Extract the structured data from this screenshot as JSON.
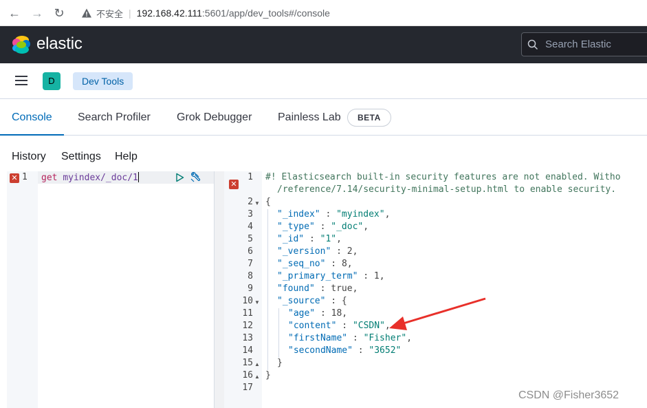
{
  "browser": {
    "back": "←",
    "forward": "→",
    "reload": "↻",
    "insecure_label": "不安全",
    "url_host": "192.168.42.111",
    "url_rest": ":5601/app/dev_tools#/console"
  },
  "header": {
    "brand": "elastic",
    "search_placeholder": "Search Elastic"
  },
  "app_bar": {
    "space_initial": "D",
    "breadcrumb": "Dev Tools"
  },
  "tabs": [
    {
      "label": "Console",
      "active": true
    },
    {
      "label": "Search Profiler"
    },
    {
      "label": "Grok Debugger"
    },
    {
      "label": "Painless Lab"
    }
  ],
  "beta_badge": "BETA",
  "console_menu": {
    "history": "History",
    "settings": "Settings",
    "help": "Help"
  },
  "request": {
    "line_number": "1",
    "method": "get",
    "path": "myindex/_doc/1"
  },
  "response": {
    "comment_1": "#! Elasticsearch built-in security features are not enabled. Witho",
    "comment_2": "/reference/7.14/security-minimal-setup.html to enable security.",
    "lines": [
      {
        "n": "1"
      },
      {
        "n": "2"
      },
      {
        "n": "3"
      },
      {
        "n": "4"
      },
      {
        "n": "5"
      },
      {
        "n": "6"
      },
      {
        "n": "7"
      },
      {
        "n": "8"
      },
      {
        "n": "9"
      },
      {
        "n": "10"
      },
      {
        "n": "11"
      },
      {
        "n": "12"
      },
      {
        "n": "13"
      },
      {
        "n": "14"
      },
      {
        "n": "15"
      },
      {
        "n": "16"
      },
      {
        "n": "17"
      }
    ],
    "open_brace": "{",
    "close_brace": "}",
    "k_index": "\"_index\"",
    "v_index": "\"myindex\"",
    "k_type": "\"_type\"",
    "v_type": "\"_doc\"",
    "k_id": "\"_id\"",
    "v_id": "\"1\"",
    "k_version": "\"_version\"",
    "v_version": "2",
    "k_seq": "\"_seq_no\"",
    "v_seq": "8",
    "k_primary": "\"_primary_term\"",
    "v_primary": "1",
    "k_found": "\"found\"",
    "v_found": "true",
    "k_source": "\"_source\"",
    "k_age": "\"age\"",
    "v_age": "18",
    "k_content": "\"content\"",
    "v_content": "\"CSDN\"",
    "k_first": "\"firstName\"",
    "v_first": "\"Fisher\"",
    "k_second": "\"secondName\"",
    "v_second": "\"3652\""
  },
  "watermark": "CSDN @Fisher3652",
  "colors": {
    "header_bg": "#25282f",
    "accent": "#006bb8",
    "error": "#cc3f30",
    "arrow": "#e8302a"
  }
}
